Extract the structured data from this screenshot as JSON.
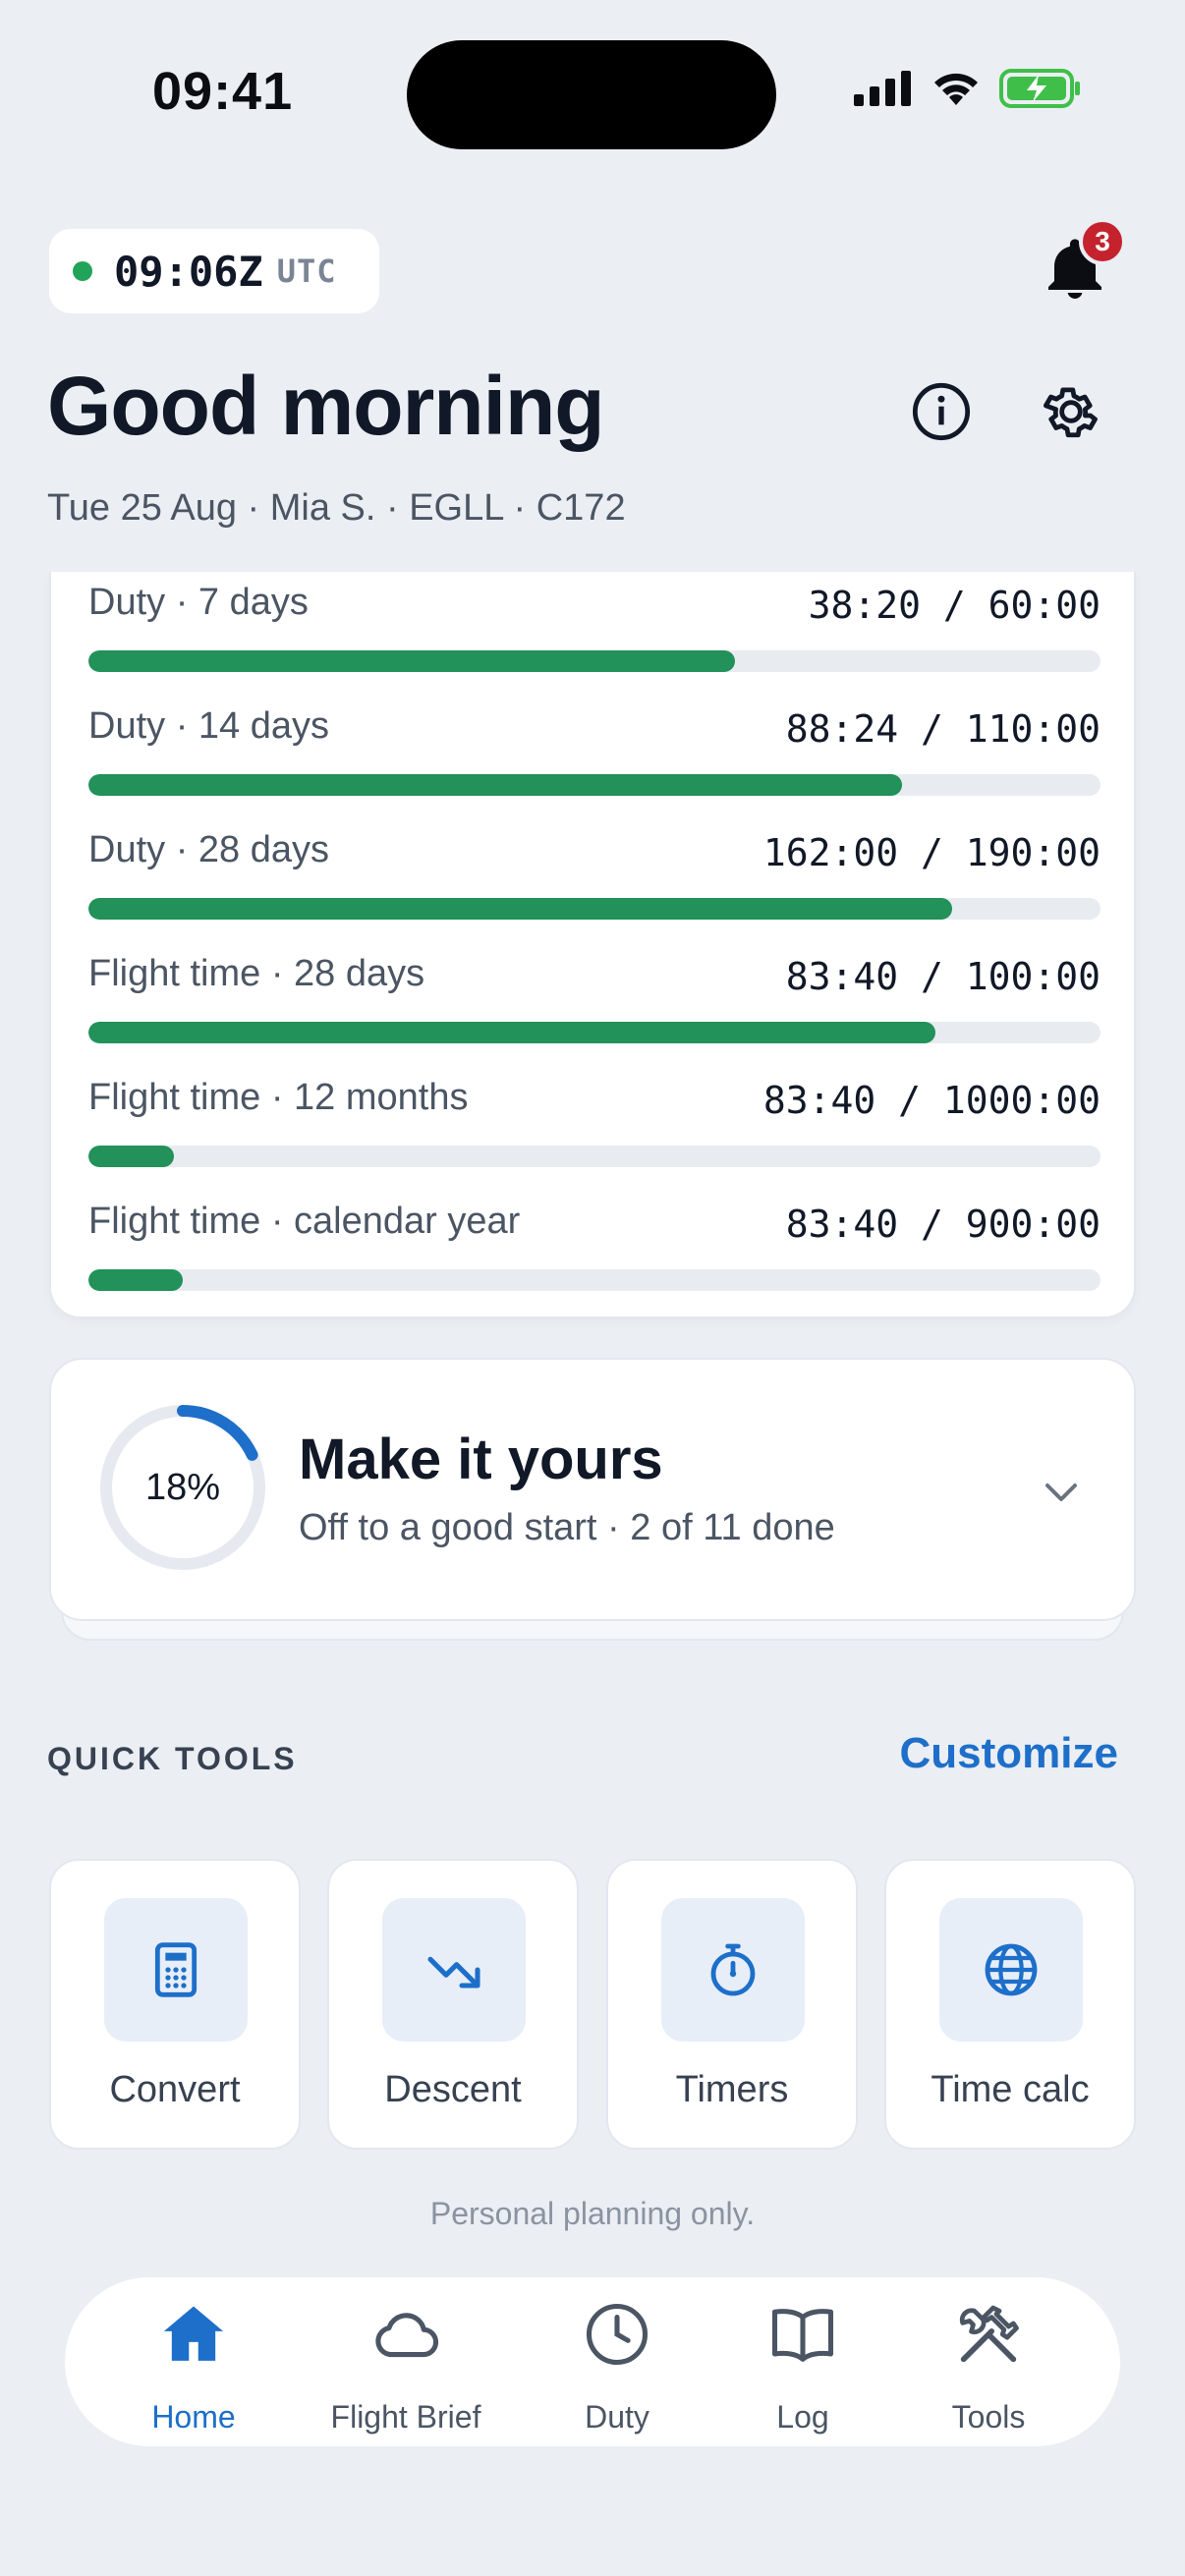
{
  "status_bar": {
    "time": "09:41"
  },
  "utc": {
    "time": "09:06Z",
    "label": "UTC"
  },
  "notifications": {
    "badge": "3"
  },
  "header": {
    "greeting": "Good morning",
    "subline": "Tue 25 Aug · Mia S. · EGLL · C172"
  },
  "limits": [
    {
      "label": "Duty · 7 days",
      "value": "38:20 / 60:00",
      "fraction": 0.639
    },
    {
      "label": "Duty · 14 days",
      "value": "88:24 / 110:00",
      "fraction": 0.804
    },
    {
      "label": "Duty · 28 days",
      "value": "162:00 / 190:00",
      "fraction": 0.853
    },
    {
      "label": "Flight time · 28 days",
      "value": "83:40 / 100:00",
      "fraction": 0.837
    },
    {
      "label": "Flight time · 12 months",
      "value": "83:40 / 1000:00",
      "fraction": 0.084
    },
    {
      "label": "Flight time · calendar year",
      "value": "83:40 / 900:00",
      "fraction": 0.093
    }
  ],
  "onboarding": {
    "percent_label": "18%",
    "percent": 0.18,
    "title": "Make it yours",
    "subtitle": "Off to a good start · 2 of 11 done"
  },
  "quick_tools": {
    "title": "QUICK TOOLS",
    "customize": "Customize",
    "items": [
      {
        "label": "Convert",
        "icon": "calculator-icon"
      },
      {
        "label": "Descent",
        "icon": "trend-down-icon"
      },
      {
        "label": "Timers",
        "icon": "stopwatch-icon"
      },
      {
        "label": "Time calc",
        "icon": "globe-icon"
      }
    ]
  },
  "disclaimer": "Personal planning only.",
  "tabs": [
    {
      "label": "Home",
      "icon": "home-icon",
      "active": true
    },
    {
      "label": "Flight Brief",
      "icon": "cloud-icon"
    },
    {
      "label": "Duty",
      "icon": "clock-icon"
    },
    {
      "label": "Log",
      "icon": "book-icon"
    },
    {
      "label": "Tools",
      "icon": "tools-icon"
    }
  ],
  "colors": {
    "accent": "#1d6fc9",
    "progress": "#22915a",
    "badge": "#c4232e",
    "background": "#ebeef3"
  }
}
